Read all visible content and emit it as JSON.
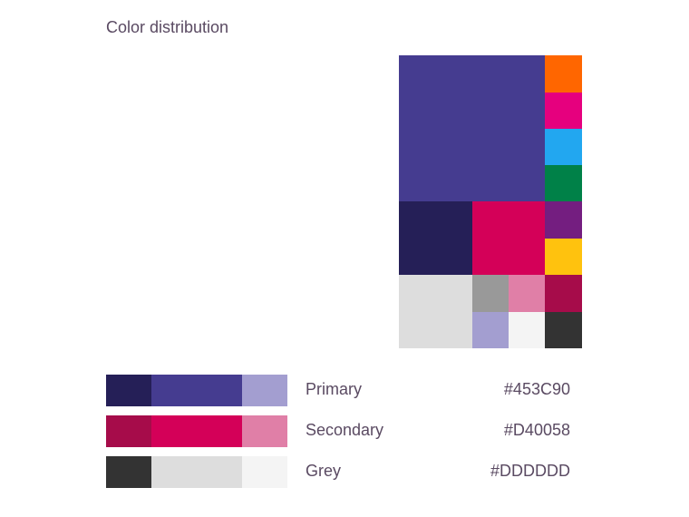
{
  "title": "Color distribution",
  "mosaic": {
    "tiles": [
      {
        "name": "primary",
        "color": "#453C90"
      },
      {
        "name": "orange",
        "color": "#FF6600"
      },
      {
        "name": "magenta",
        "color": "#E6007E"
      },
      {
        "name": "light-blue",
        "color": "#22A7F0"
      },
      {
        "name": "green",
        "color": "#008148"
      },
      {
        "name": "primary-dark",
        "color": "#251F57"
      },
      {
        "name": "secondary",
        "color": "#D40058"
      },
      {
        "name": "purple",
        "color": "#741E80"
      },
      {
        "name": "yellow",
        "color": "#FFC20E"
      },
      {
        "name": "secondary-dark",
        "color": "#A60C4A"
      },
      {
        "name": "grey",
        "color": "#DDDDDD"
      },
      {
        "name": "grey-medium",
        "color": "#999999"
      },
      {
        "name": "secondary-light",
        "color": "#E07FA7"
      },
      {
        "name": "primary-light",
        "color": "#A39ED0"
      },
      {
        "name": "grey-lightest",
        "color": "#F4F4F4"
      },
      {
        "name": "grey-dark",
        "color": "#333333"
      }
    ]
  },
  "palettes": [
    {
      "label": "Primary",
      "hex": "#453C90",
      "shades": [
        "#251F57",
        "#453C90",
        "#A39ED0"
      ]
    },
    {
      "label": "Secondary",
      "hex": "#D40058",
      "shades": [
        "#A60C4A",
        "#D40058",
        "#E07FA7"
      ]
    },
    {
      "label": "Grey",
      "hex": "#DDDDDD",
      "shades": [
        "#333333",
        "#DDDDDD",
        "#F4F4F4"
      ]
    }
  ]
}
